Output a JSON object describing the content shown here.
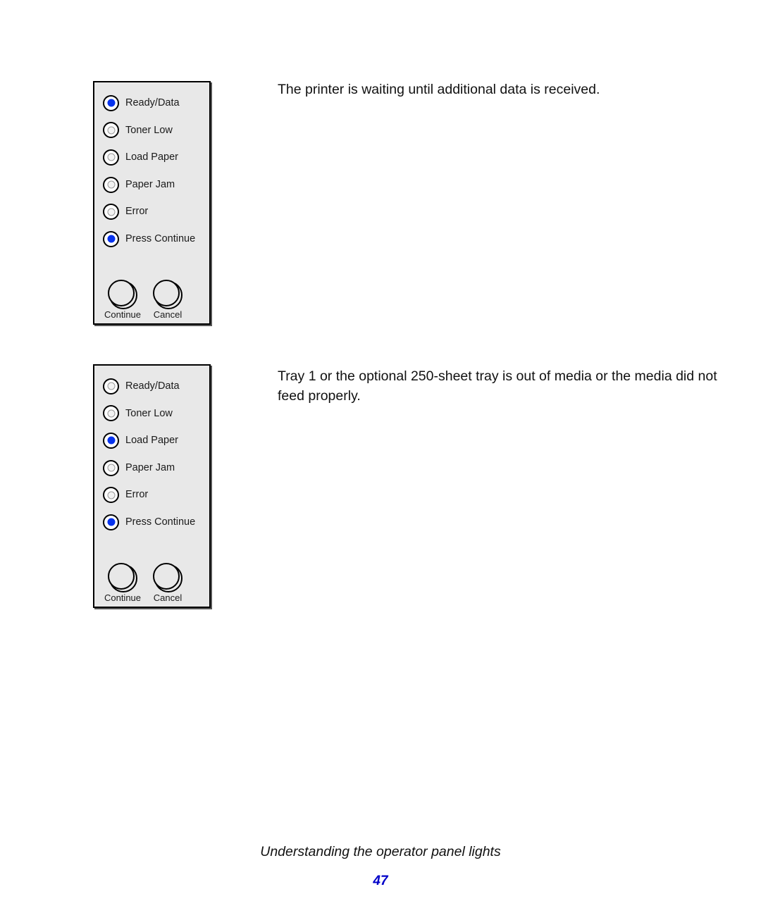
{
  "page": {
    "number": "47",
    "footer_title": "Understanding the operator panel lights",
    "page_number_color": "#0000c8",
    "background_color": "#ffffff"
  },
  "colors": {
    "led_on": "#0733ee",
    "led_off": "#f2f2f2",
    "panel_fill": "#e8e8e8",
    "panel_border": "#000000"
  },
  "panels": [
    {
      "id": "panel-1",
      "leds": [
        {
          "label": "Ready/Data",
          "state": "on"
        },
        {
          "label": "Toner Low",
          "state": "off"
        },
        {
          "label": "Load Paper",
          "state": "off"
        },
        {
          "label": "Paper Jam",
          "state": "off"
        },
        {
          "label": "Error",
          "state": "off"
        },
        {
          "label": "Press Continue",
          "state": "on"
        }
      ],
      "buttons": [
        {
          "label": "Continue"
        },
        {
          "label": "Cancel"
        }
      ],
      "description": "The printer is waiting until additional data is received."
    },
    {
      "id": "panel-2",
      "leds": [
        {
          "label": "Ready/Data",
          "state": "off"
        },
        {
          "label": "Toner Low",
          "state": "off"
        },
        {
          "label": "Load Paper",
          "state": "on"
        },
        {
          "label": "Paper Jam",
          "state": "off"
        },
        {
          "label": "Error",
          "state": "off"
        },
        {
          "label": "Press Continue",
          "state": "on"
        }
      ],
      "buttons": [
        {
          "label": "Continue"
        },
        {
          "label": "Cancel"
        }
      ],
      "description": "Tray 1 or the optional 250-sheet tray is out of media or the media did not feed properly."
    }
  ]
}
